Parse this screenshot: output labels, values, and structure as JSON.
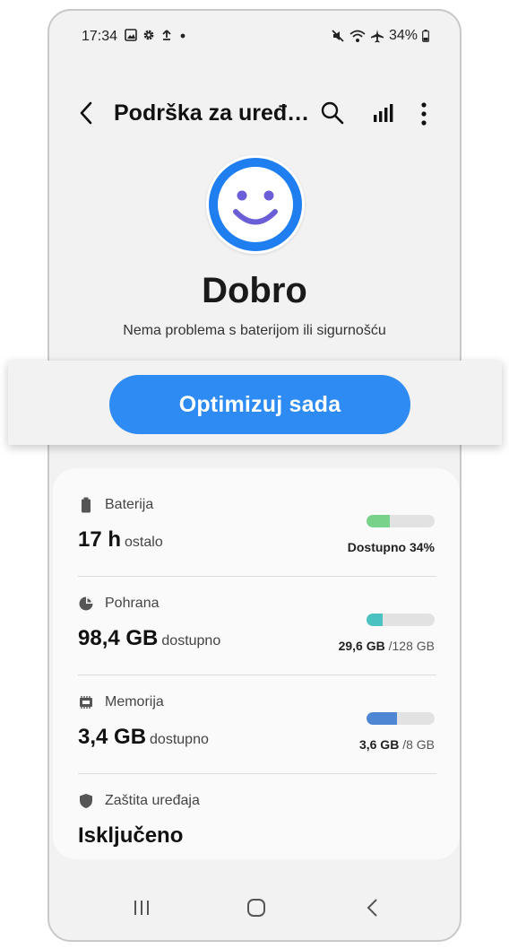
{
  "status_bar": {
    "time": "17:34",
    "battery_text": "34%",
    "left_icons": [
      "image-icon",
      "gear-icon",
      "upload-icon",
      "dot-icon"
    ],
    "right_icons": [
      "mute-icon",
      "wifi-icon",
      "airplane-icon",
      "battery-icon"
    ]
  },
  "app_bar": {
    "title": "Podrška za uređ…",
    "actions": [
      "back-icon",
      "search-icon",
      "signal-bars-icon",
      "more-vert-icon"
    ]
  },
  "hero": {
    "icon": "smiley-face-icon",
    "status": "Dobro",
    "subtitle": "Nema problema s baterijom ili sigurnošću"
  },
  "optimize_button": {
    "label": "Optimizuj sada"
  },
  "items": [
    {
      "label": "Baterija",
      "icon": "battery-icon",
      "value": "17 h",
      "unit": "ostalo",
      "right_bold": "Dostupno 34%",
      "right_muted": "",
      "fill": 0.34,
      "color": "#79d28a"
    },
    {
      "label": "Pohrana",
      "icon": "pie-chart-icon",
      "value": "98,4 GB",
      "unit": "dostupno",
      "right_bold": "29,6 GB",
      "right_muted": "/128 GB",
      "fill": 0.231,
      "color": "#4ac2c2"
    },
    {
      "label": "Memorija",
      "icon": "memory-chip-icon",
      "value": "3,4 GB",
      "unit": "dostupno",
      "right_bold": "3,6 GB",
      "right_muted": "/8 GB",
      "fill": 0.45,
      "color": "#4f86d4"
    },
    {
      "label": "Zaštita uređaja",
      "icon": "shield-icon",
      "value": "Isključeno"
    }
  ],
  "nav_bar": {
    "icons": [
      "recent-apps-icon",
      "home-icon",
      "back-nav-icon"
    ]
  },
  "colors": {
    "accent": "#2d8bf3",
    "face_ring": "#1f7ff0",
    "background": "#f2f2f2"
  }
}
